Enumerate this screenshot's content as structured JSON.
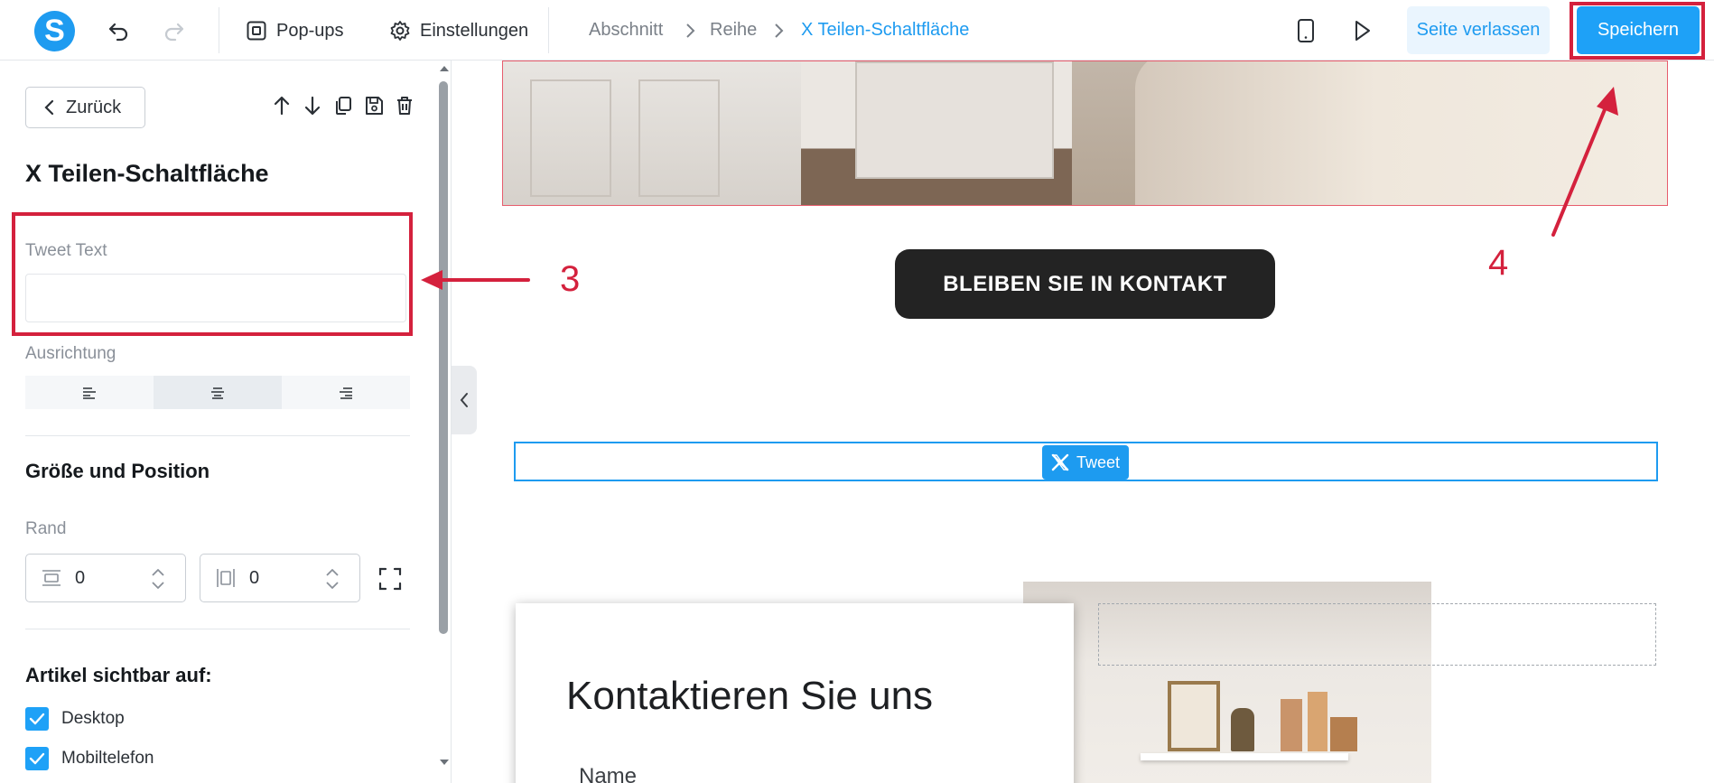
{
  "topbar": {
    "logo_letter": "S",
    "popups_label": "Pop-ups",
    "settings_label": "Einstellungen",
    "breadcrumbs": [
      "Abschnitt",
      "Reihe",
      "X Teilen-Schaltfläche"
    ],
    "leave_label": "Seite verlassen",
    "save_label": "Speichern"
  },
  "sidebar": {
    "back_label": "Zurück",
    "title": "X Teilen-Schaltfläche",
    "tweet_text_label": "Tweet Text",
    "tweet_text_value": "",
    "alignment_label": "Ausrichtung",
    "alignment_selected": "center",
    "size_position_title": "Größe und Position",
    "margin_label": "Rand",
    "margin_horizontal": "0",
    "margin_vertical": "0",
    "visible_on_title": "Artikel sichtbar auf:",
    "visible_on": [
      {
        "label": "Desktop",
        "checked": true
      },
      {
        "label": "Mobiltelefon",
        "checked": true
      }
    ]
  },
  "canvas": {
    "contact_button_label": "BLEIBEN SIE IN KONTAKT",
    "tweet_button_label": "Tweet",
    "form_title": "Kontaktieren Sie uns",
    "form_name_label": "Name"
  },
  "annotations": {
    "step_3": "3",
    "step_4": "4"
  },
  "colors": {
    "accent": "#1e9bf0",
    "highlight": "#d4213d",
    "dark_button": "#232323"
  }
}
